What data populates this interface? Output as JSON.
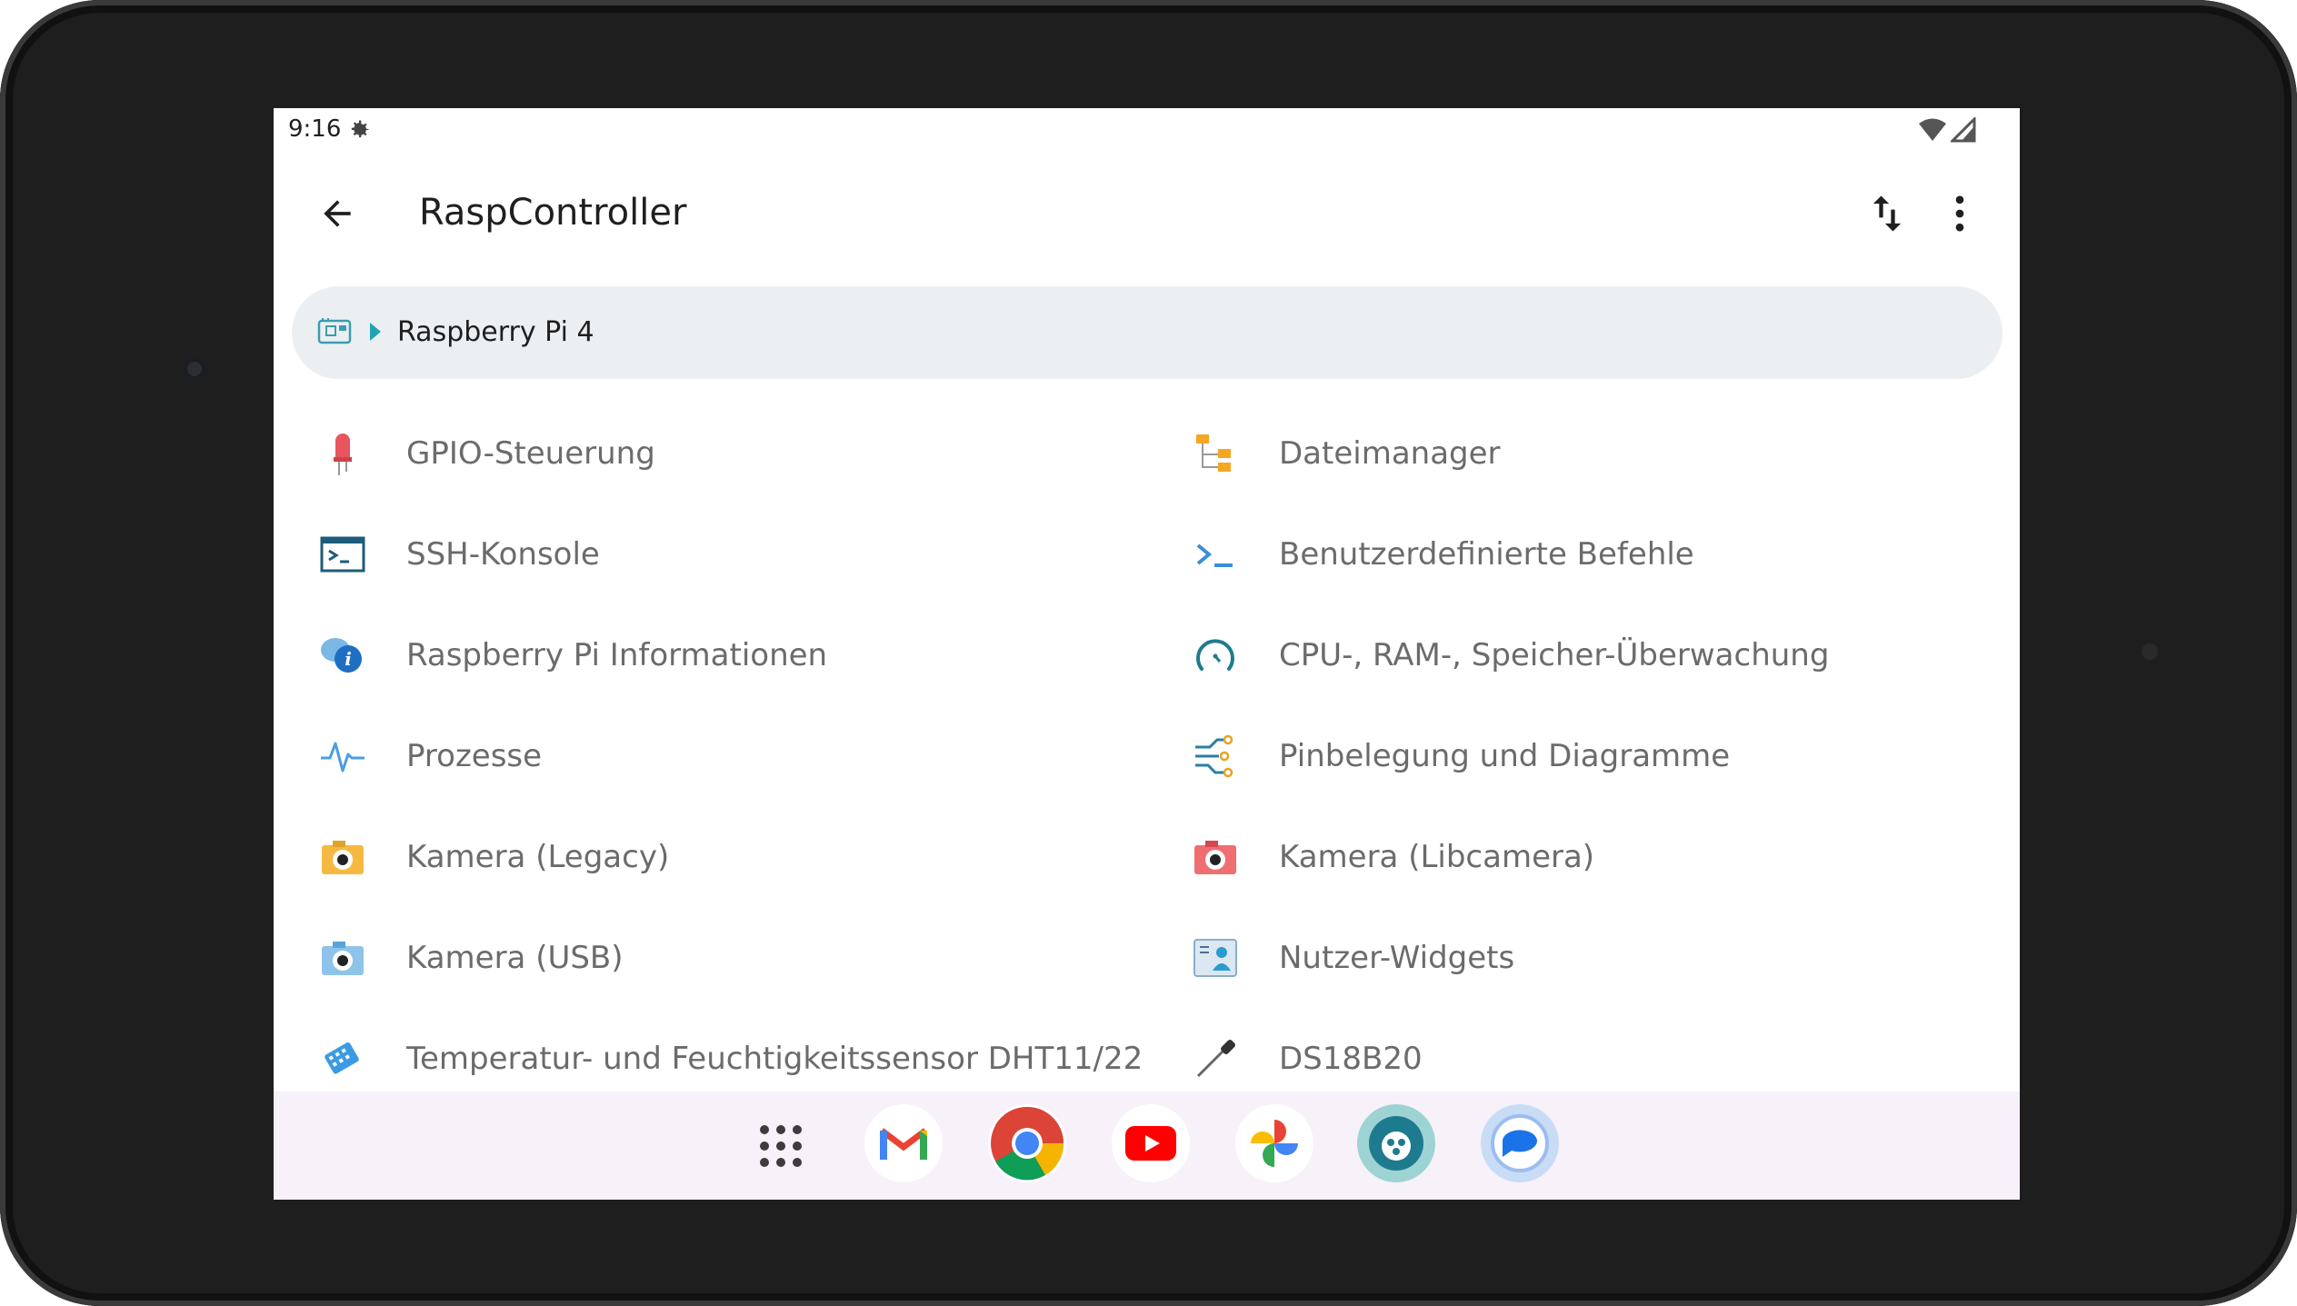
{
  "status": {
    "time": "9:16",
    "settings_icon": "gear-icon",
    "wifi_icon": "wifi-icon",
    "signal_icon": "signal-icon"
  },
  "appbar": {
    "title": "RaspController",
    "back_icon": "arrow-back-icon",
    "sort_icon": "swap-vert-icon",
    "more_icon": "more-vert-icon"
  },
  "device": {
    "name": "Raspberry Pi 4",
    "icon": "raspberry-board-icon"
  },
  "menu": {
    "left": [
      {
        "label": "GPIO-Steuerung",
        "icon": "led-icon"
      },
      {
        "label": "SSH-Konsole",
        "icon": "terminal-window-icon"
      },
      {
        "label": "Raspberry Pi Informationen",
        "icon": "info-chat-icon"
      },
      {
        "label": "Prozesse",
        "icon": "pulse-icon"
      },
      {
        "label": "Kamera (Legacy)",
        "icon": "camera-yellow-icon"
      },
      {
        "label": "Kamera (USB)",
        "icon": "camera-blue-icon"
      },
      {
        "label": "Temperatur- und Feuchtigkeitssensor DHT11/22",
        "icon": "sensor-icon"
      }
    ],
    "right": [
      {
        "label": "Dateimanager",
        "icon": "folder-tree-icon"
      },
      {
        "label": "Benutzerdefinierte Befehle",
        "icon": "prompt-icon"
      },
      {
        "label": "CPU-, RAM-, Speicher-Überwachung",
        "icon": "gauge-icon"
      },
      {
        "label": "Pinbelegung und Diagramme",
        "icon": "pinout-icon"
      },
      {
        "label": "Kamera (Libcamera)",
        "icon": "camera-red-icon"
      },
      {
        "label": "Nutzer-Widgets",
        "icon": "widgets-icon"
      },
      {
        "label": "DS18B20",
        "icon": "probe-icon"
      }
    ]
  },
  "dock": [
    "app-drawer-icon",
    "gmail-icon",
    "chrome-icon",
    "youtube-icon",
    "photos-icon",
    "raspcontroller-icon",
    "messages-icon"
  ],
  "colors": {
    "accent": "#1fa3b5",
    "pill_bg": "#eceff2",
    "dock_bg": "#f7f1fa",
    "text_secondary": "#6b6b6b"
  }
}
